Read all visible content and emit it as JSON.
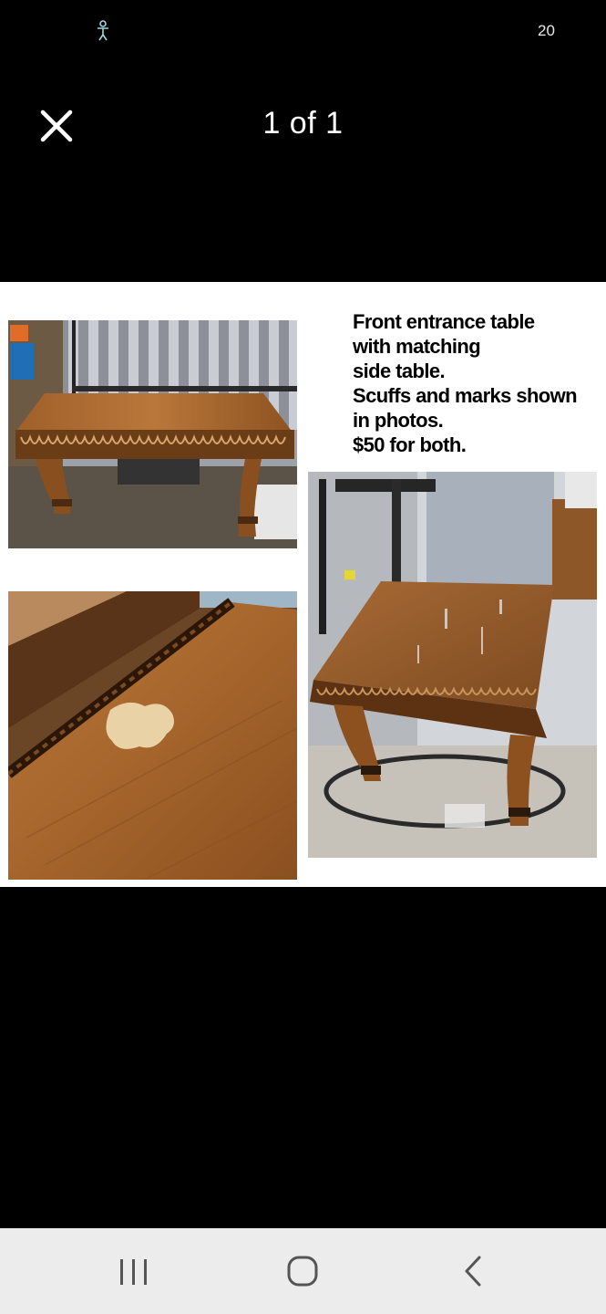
{
  "status_bar": {
    "left_icon": "accessibility-icon",
    "right_text": "20"
  },
  "viewer": {
    "close_icon": "close-icon",
    "counter": "1 of 1"
  },
  "listing_image": {
    "caption_lines": [
      "Front entrance table",
      "with matching",
      "side table.",
      "Scuffs and marks shown",
      "in photos.",
      "$50 for both."
    ]
  },
  "nav_bar": {
    "recent_apps_icon": "recent-apps-icon",
    "home_icon": "home-icon",
    "back_icon": "back-icon"
  },
  "colors": {
    "background": "#000000",
    "photo_background": "#ffffff",
    "nav_background": "#ececec"
  }
}
